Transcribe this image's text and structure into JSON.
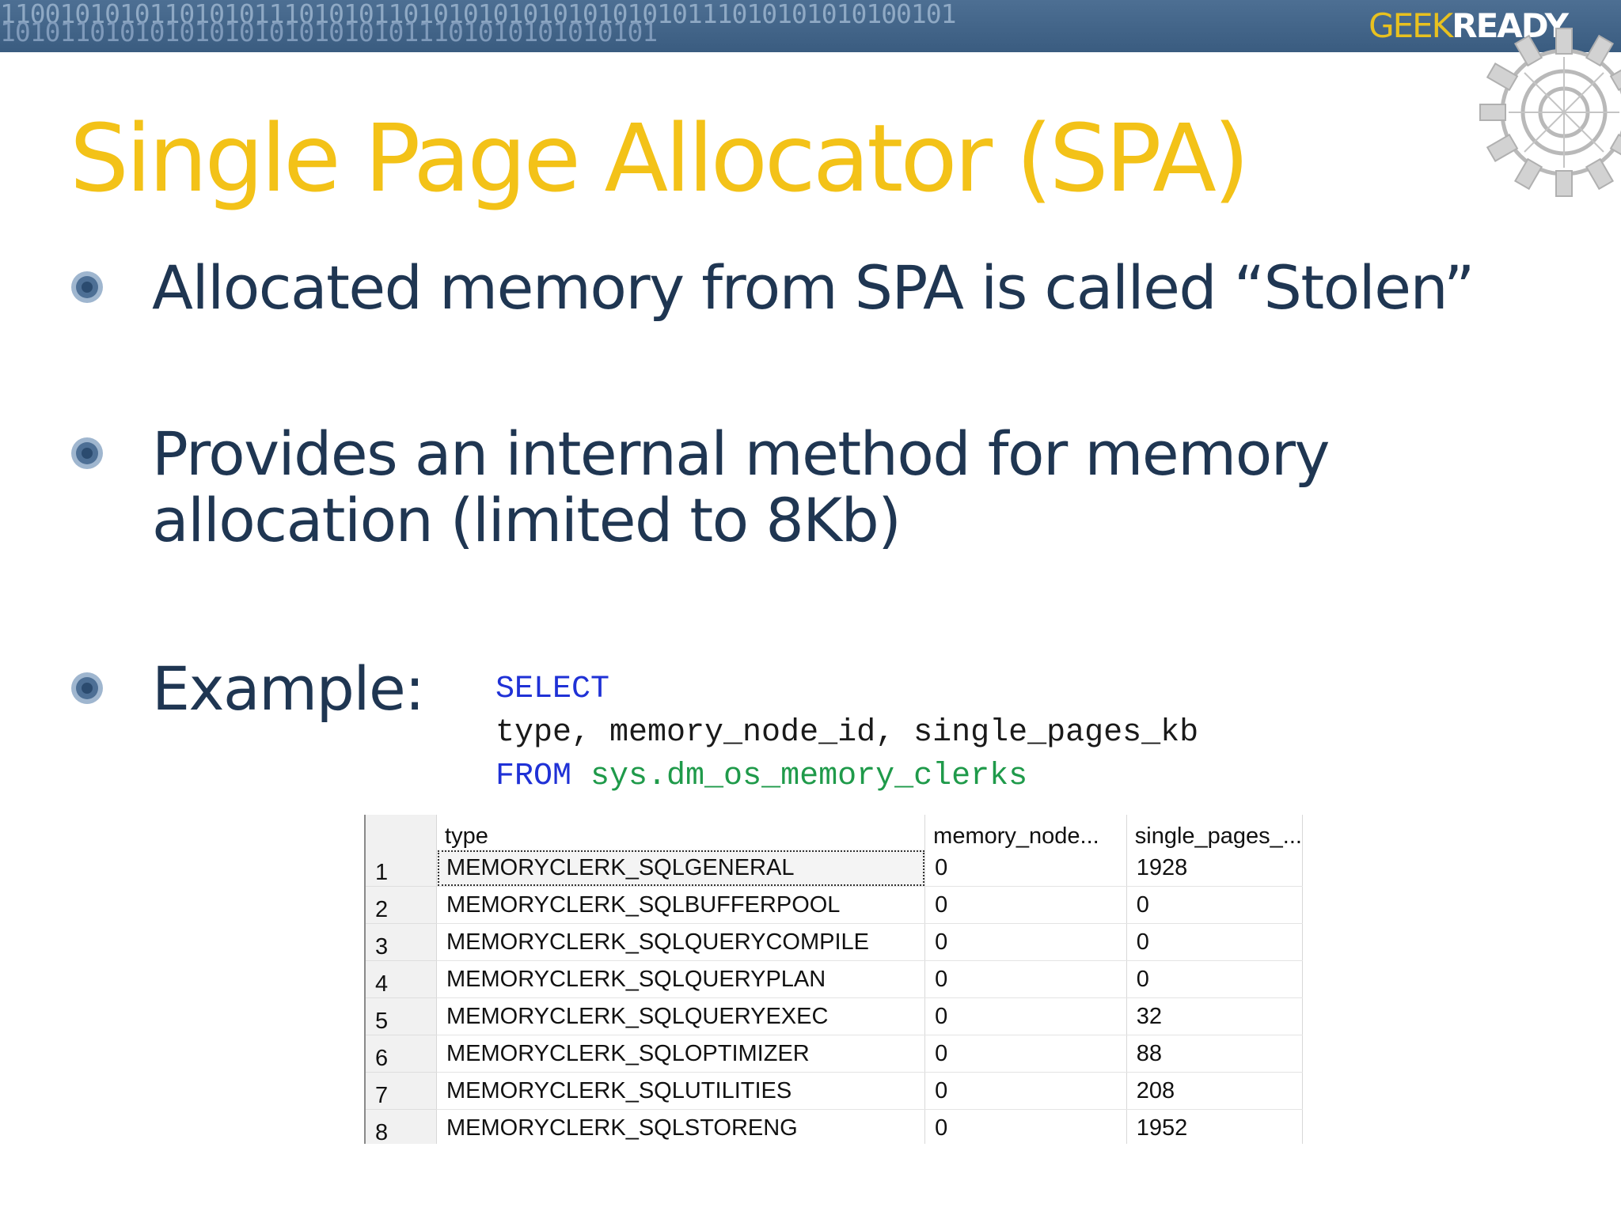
{
  "banner": {
    "binary_line1": "1100101010110101011101010110101010101010101010111010101010100101",
    "binary_line2": "10101101010101010101010101011101010101010101",
    "brand_geek": "GEEK",
    "brand_ready": "READY"
  },
  "slide": {
    "title": "Single Page Allocator (SPA)",
    "bullets": [
      {
        "lines": [
          "Allocated memory from SPA is called “Stolen”"
        ]
      },
      {
        "lines": [
          "Provides an internal method for memory",
          "allocation (limited to 8Kb)"
        ]
      },
      {
        "lines": [
          "Example:"
        ]
      }
    ]
  },
  "code": {
    "line1_keyword": "SELECT",
    "line2": "type, memory_node_id, single_pages_kb",
    "line3_keyword": "FROM",
    "line3_object": "sys.dm_os_memory_clerks"
  },
  "results": {
    "columns": [
      "",
      "type",
      "memory_node...",
      "single_pages_..."
    ],
    "rows": [
      [
        "1",
        "MEMORYCLERK_SQLGENERAL",
        "0",
        "1928"
      ],
      [
        "2",
        "MEMORYCLERK_SQLBUFFERPOOL",
        "0",
        "0"
      ],
      [
        "3",
        "MEMORYCLERK_SQLQUERYCOMPILE",
        "0",
        "0"
      ],
      [
        "4",
        "MEMORYCLERK_SQLQUERYPLAN",
        "0",
        "0"
      ],
      [
        "5",
        "MEMORYCLERK_SQLQUERYEXEC",
        "0",
        "32"
      ],
      [
        "6",
        "MEMORYCLERK_SQLOPTIMIZER",
        "0",
        "88"
      ],
      [
        "7",
        "MEMORYCLERK_SQLUTILITIES",
        "0",
        "208"
      ],
      [
        "8",
        "MEMORYCLERK_SQLSTORENG",
        "0",
        "1952"
      ]
    ]
  },
  "colors": {
    "title": "#f3c218",
    "body_text": "#1f3652",
    "banner": "#3f6185",
    "sql_keyword": "#1f31d6",
    "sql_object": "#1f9a4a"
  }
}
